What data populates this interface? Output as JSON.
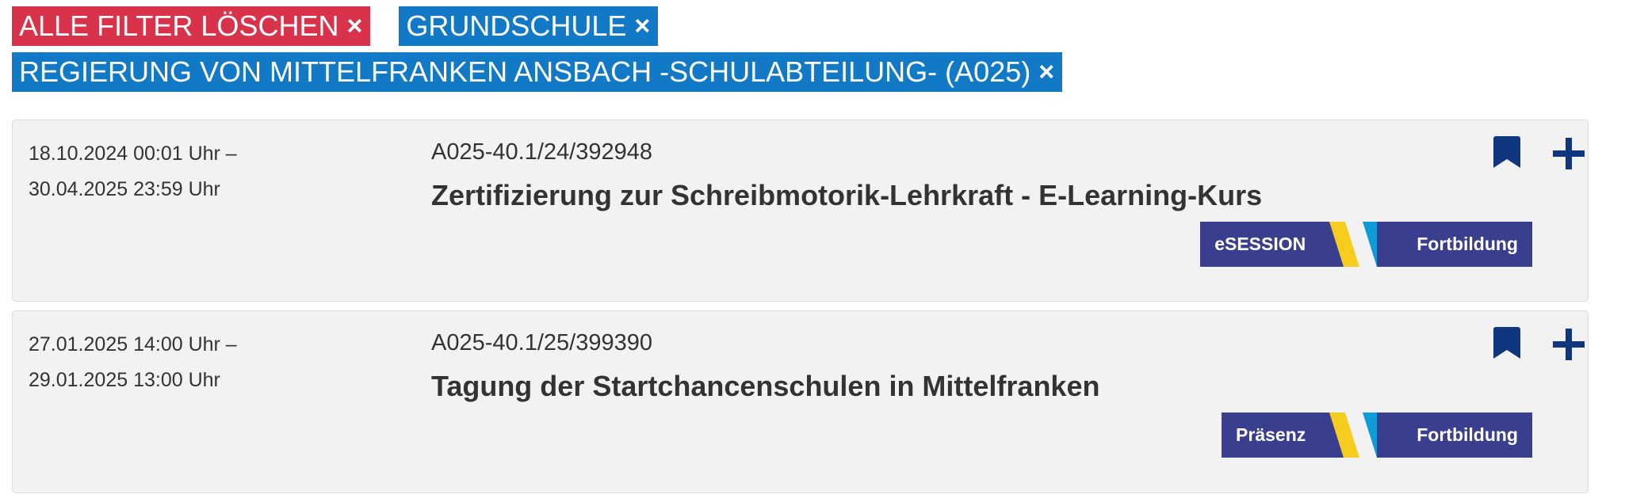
{
  "filters": {
    "clear_all": "ALLE FILTER LÖSCHEN",
    "school_type": "GRUNDSCHULE",
    "authority": "REGIERUNG VON MITTELFRANKEN ANSBACH -SCHULABTEILUNG- (A025)",
    "remove_glyph": "×"
  },
  "colors": {
    "clear_chip": "#d8334a",
    "filter_chip": "#1179c5",
    "tag_bg": "#3a3e8f",
    "stripe_yellow": "#f6cd1e",
    "stripe_blue": "#0f9ad8",
    "icon_blue": "#10367f"
  },
  "results": [
    {
      "date_start": "18.10.2024 00:01 Uhr –",
      "date_end": "30.04.2025 23:59 Uhr",
      "id": "A025-40.1/24/392948",
      "title": "Zertifizierung zur Schreibmotorik-Lehrkraft - E-Learning-Kurs",
      "format_tag": "eSESSION",
      "type_tag": "Fortbildung",
      "icons": [
        "bookmark-icon",
        "plus-icon"
      ]
    },
    {
      "date_start": "27.01.2025 14:00 Uhr –",
      "date_end": "29.01.2025 13:00 Uhr",
      "id": "A025-40.1/25/399390",
      "title": "Tagung der Startchancenschulen in Mittelfranken",
      "format_tag": "Präsenz",
      "type_tag": "Fortbildung",
      "icons": [
        "bookmark-icon",
        "plus-icon"
      ]
    }
  ]
}
